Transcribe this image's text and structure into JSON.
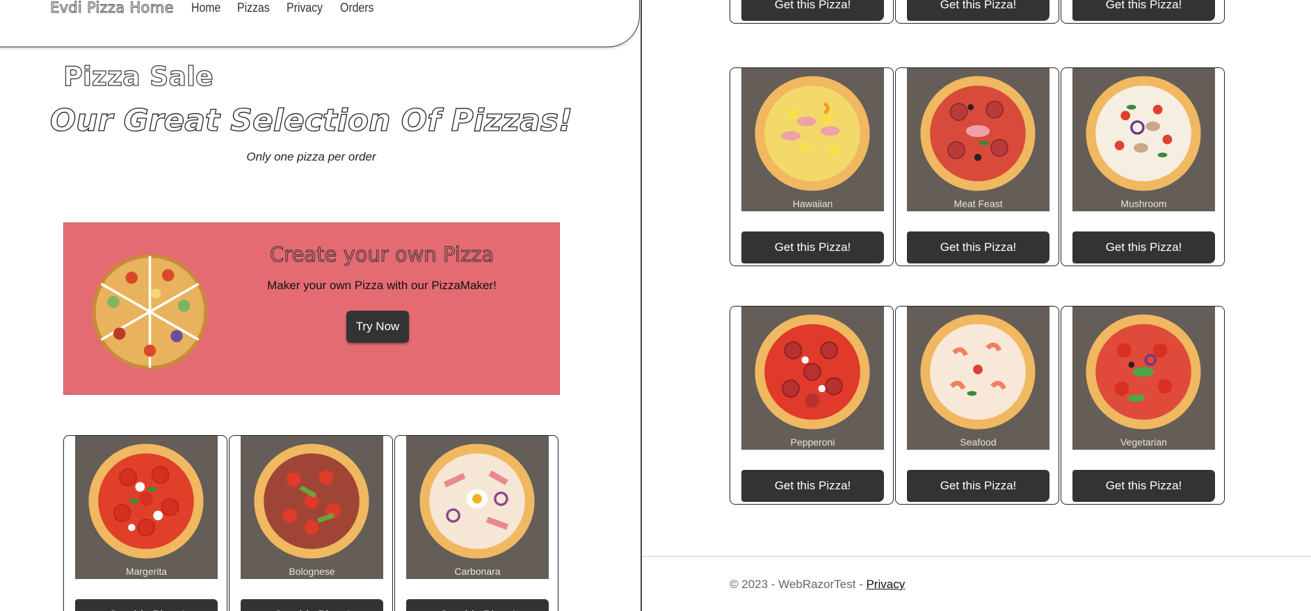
{
  "nav": {
    "brand": "Evdi Pizza Home",
    "links": [
      "Home",
      "Pizzas",
      "Privacy",
      "Orders"
    ]
  },
  "page": {
    "title": "Pizza Sale",
    "headline": "Our Great Selection Of Pizzas!",
    "subline": "Only one pizza per order"
  },
  "promo": {
    "title": "Create your own Pizza",
    "subtitle": "Maker your own Pizza with our PizzaMaker!",
    "button": "Try Now"
  },
  "cta_label": "Get this Pizza!",
  "pizzas_left": [
    {
      "name": "Margerita",
      "button": "Get this Pizza!"
    },
    {
      "name": "Bolognese",
      "button": "Get this Pizza!"
    },
    {
      "name": "Carbonara",
      "button": "Get this Pizza!"
    }
  ],
  "pizzas_right_top": [
    {
      "button": "Get this Pizza!"
    },
    {
      "button": "Get this Pizza!"
    },
    {
      "button": "Get this Pizza!"
    }
  ],
  "pizzas_right_row2": [
    {
      "name": "Hawaiian",
      "button": "Get this Pizza!"
    },
    {
      "name": "Meat Feast",
      "button": "Get this Pizza!"
    },
    {
      "name": "Mushroom",
      "button": "Get this Pizza!"
    }
  ],
  "pizzas_right_row3": [
    {
      "name": "Pepperoni",
      "button": "Get this Pizza!"
    },
    {
      "name": "Seafood",
      "button": "Get this Pizza!"
    },
    {
      "name": "Vegetarian",
      "button": "Get this Pizza!"
    }
  ],
  "footer": {
    "text": "© 2023 - WebRazorTest - ",
    "link": "Privacy"
  },
  "colors": {
    "promo_bg": "#e56b73",
    "card_img_bg": "#645d58",
    "button_bg": "#333333"
  }
}
